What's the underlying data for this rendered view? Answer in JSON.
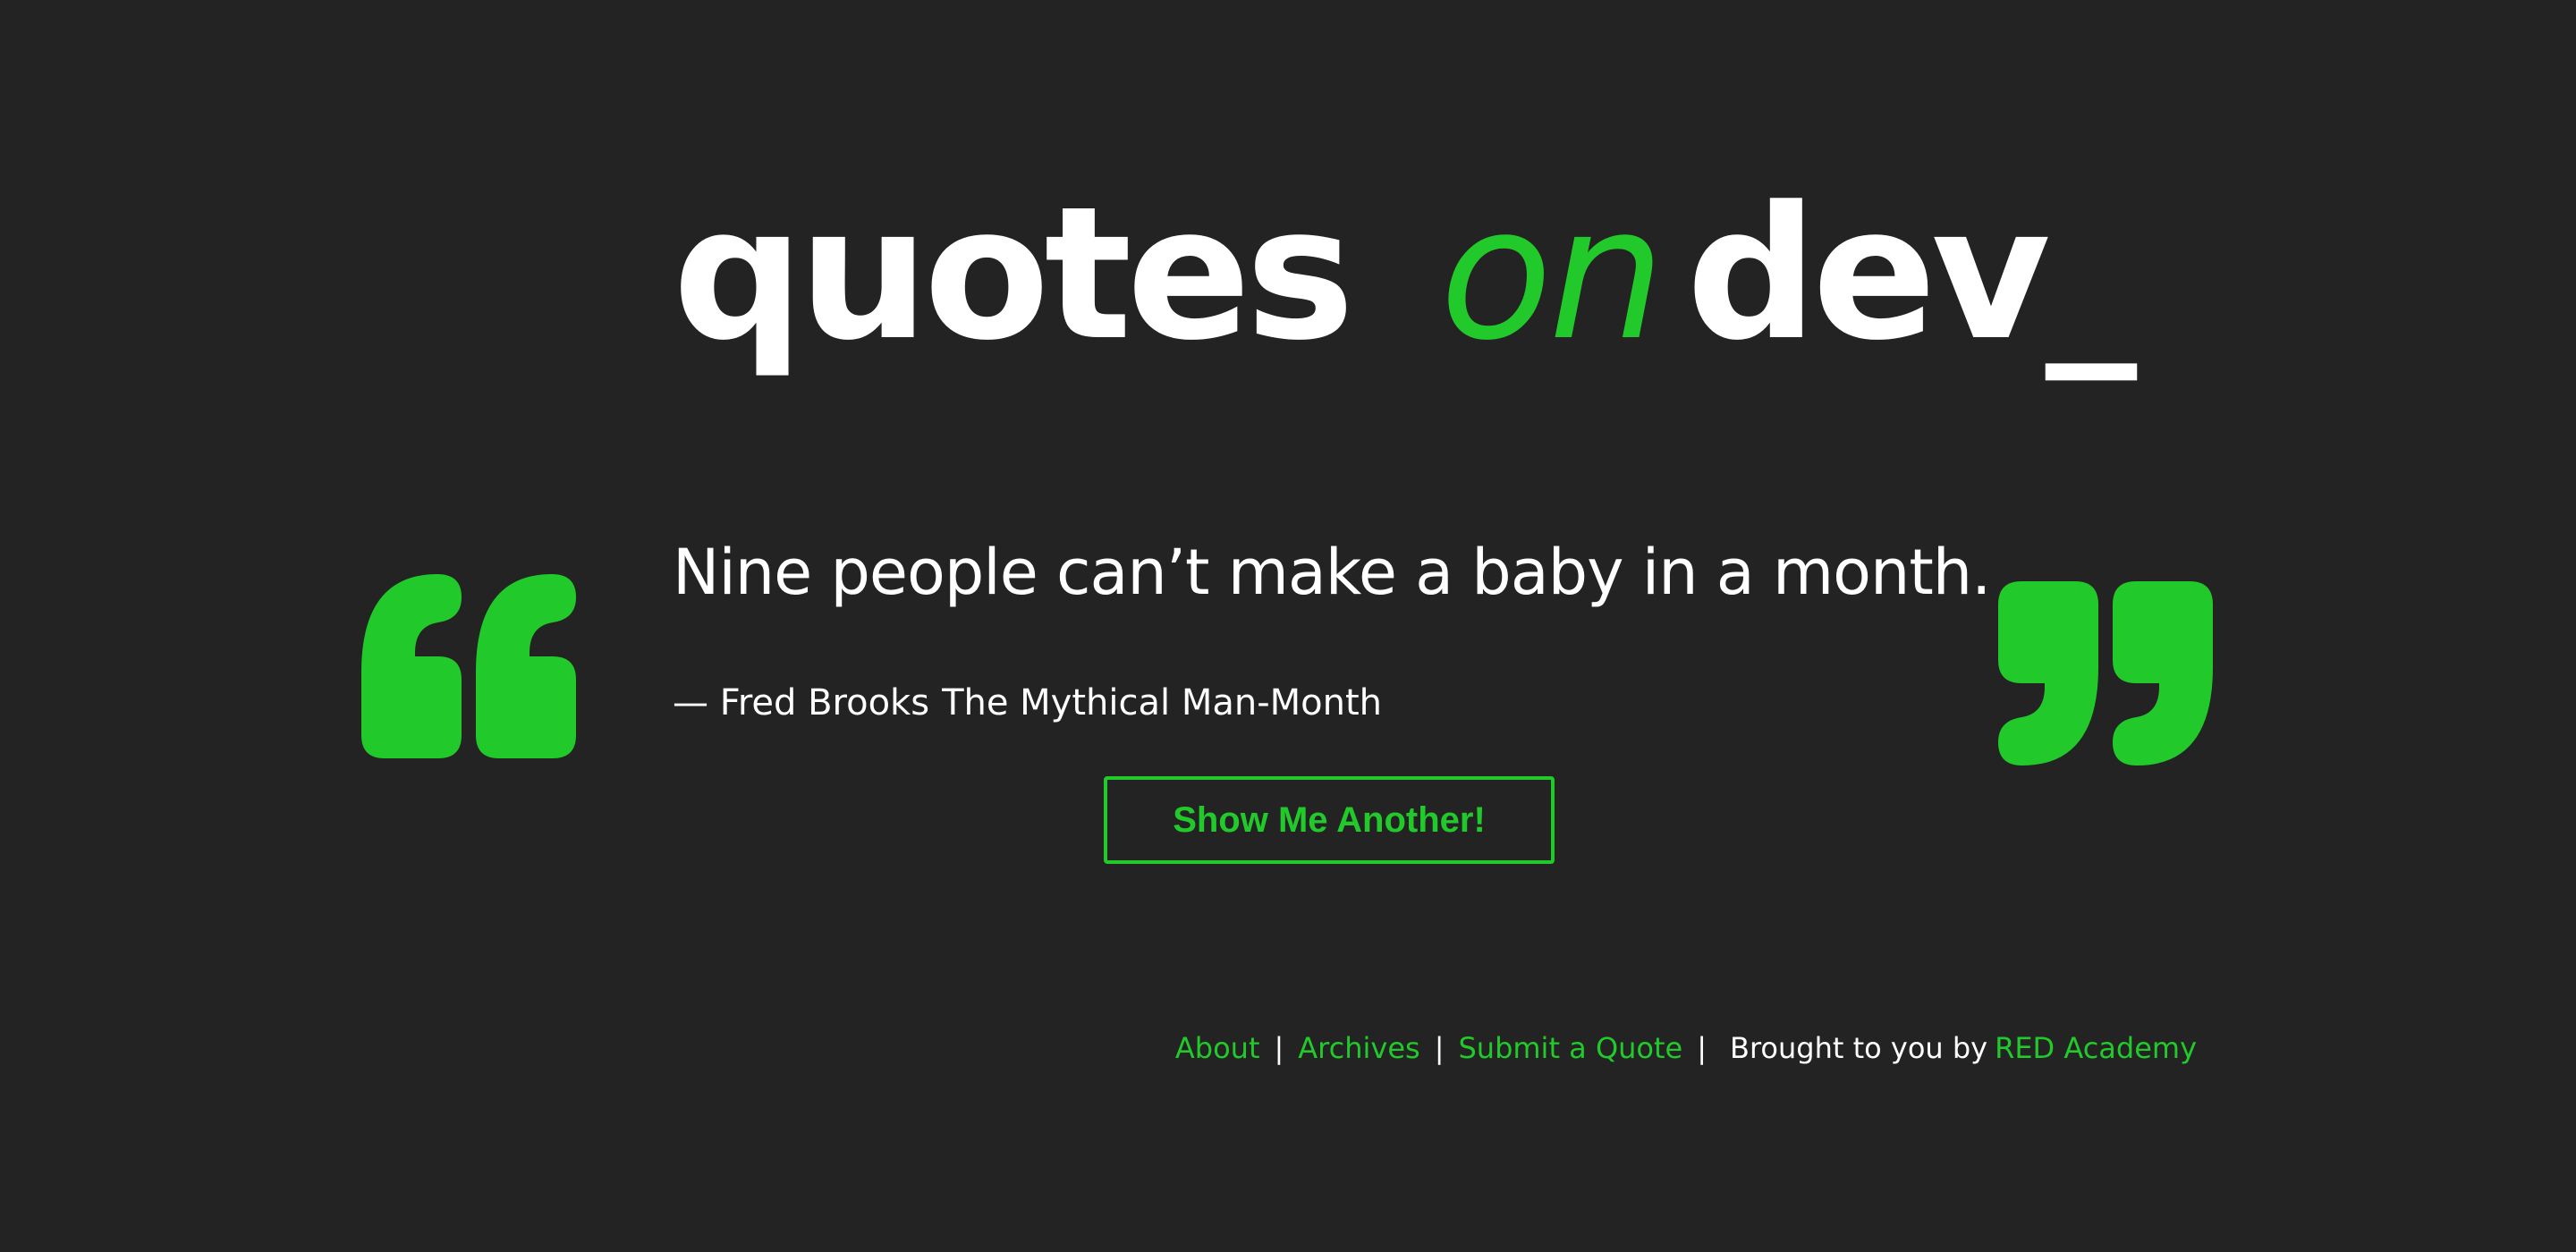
{
  "brand": {
    "word1": "quotes",
    "word2": "on",
    "word3": "dev",
    "cursor": "_",
    "accent_color": "#22c92a",
    "background_color": "#232323"
  },
  "quote": {
    "text": "Nine people can’t make a baby in a month.",
    "author": "— Fred Brooks",
    "source": "The Mythical Man-Month",
    "open_icon": "open-quote-icon",
    "close_icon": "close-quote-icon"
  },
  "actions": {
    "another_label": "Show Me Another!"
  },
  "footer": {
    "links": [
      "About",
      "Archives",
      "Submit a Quote"
    ],
    "separator": "|",
    "credit_text": "Brought to you by",
    "credit_link": "RED Academy"
  }
}
